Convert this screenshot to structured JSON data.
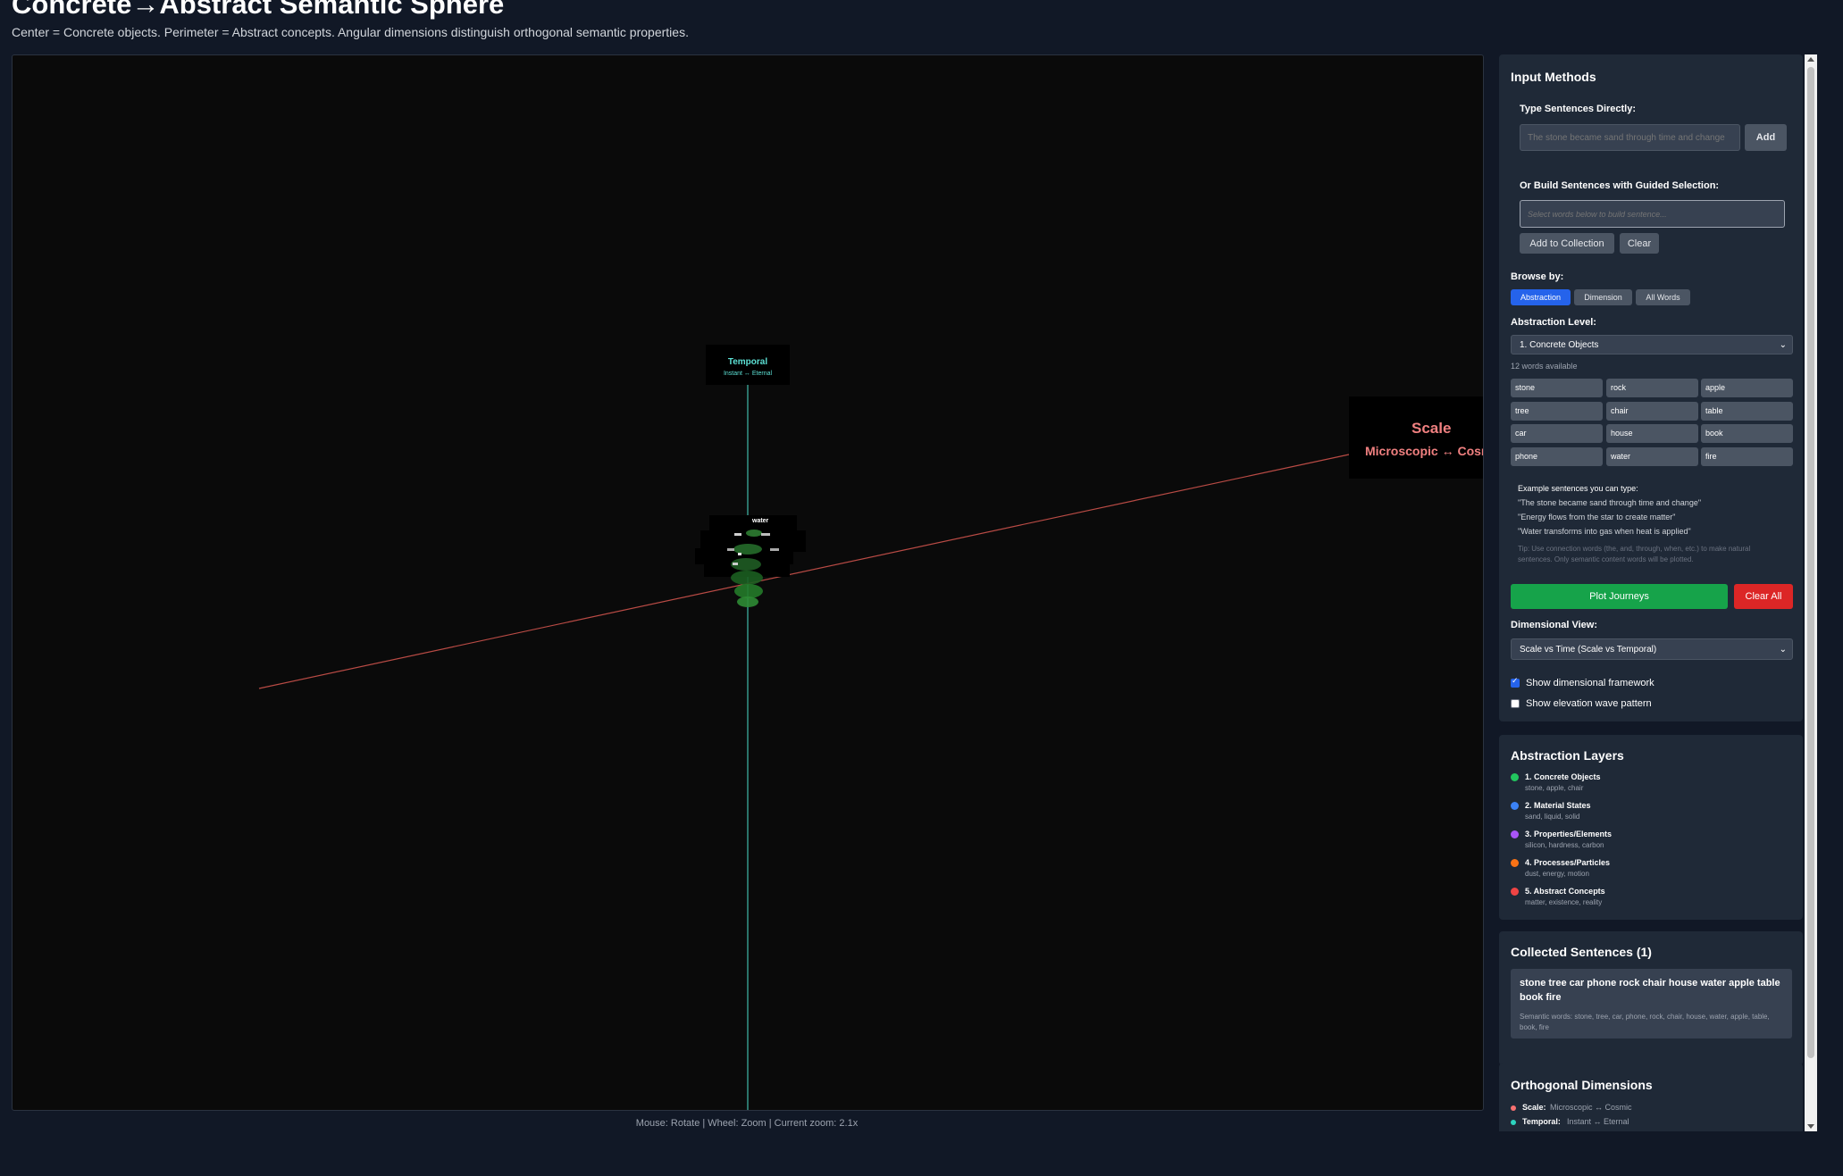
{
  "page": {
    "title": "Concrete→Abstract Semantic Sphere",
    "subtitle": "Center = Concrete objects. Perimeter = Abstract concepts. Angular dimensions distinguish orthogonal semantic properties."
  },
  "viz": {
    "temporal_axis": {
      "name": "Temporal",
      "range": "Instant ↔ Eternal",
      "color": "#5ce0d4"
    },
    "scale_axis": {
      "name": "Scale",
      "range": "Microscopic ↔ Cosmic",
      "color": "#f08080"
    },
    "visible_word": "water",
    "status": "Mouse: Rotate | Wheel: Zoom | Current zoom: 2.1x"
  },
  "input_panel": {
    "title": "Input Methods",
    "type_label": "Type Sentences Directly:",
    "type_placeholder": "The stone became sand through time and change",
    "add_label": "Add",
    "guided_label": "Or Build Sentences with Guided Selection:",
    "guided_placeholder": "Select words below to build sentence...",
    "add_collection_label": "Add to Collection",
    "clear_label": "Clear",
    "browse_label": "Browse by:",
    "browse_tabs": [
      "Abstraction",
      "Dimension",
      "All Words"
    ],
    "active_browse_tab": "Abstraction",
    "level_label": "Abstraction Level:",
    "level_selected": "1. Concrete Objects",
    "words_available": "12 words available",
    "words": [
      "stone",
      "rock",
      "apple",
      "tree",
      "chair",
      "table",
      "car",
      "house",
      "book",
      "phone",
      "water",
      "fire"
    ],
    "examples_title": "Example sentences you can type:",
    "examples": [
      "\"The stone became sand through time and change\"",
      "\"Energy flows from the star to create matter\"",
      "\"Water transforms into gas when heat is applied\""
    ],
    "tip": "Tip: Use connection words (the, and, through, when, etc.) to make natural sentences. Only semantic content words will be plotted.",
    "plot_label": "Plot Journeys",
    "clear_all_label": "Clear All",
    "dim_view_label": "Dimensional View:",
    "dim_view_selected": "Scale vs Time (Scale vs Temporal)",
    "show_framework_label": "Show dimensional framework",
    "show_framework_checked": true,
    "show_wave_label": "Show elevation wave pattern",
    "show_wave_checked": false
  },
  "layers_panel": {
    "title": "Abstraction Layers",
    "layers": [
      {
        "name": "1. Concrete Objects",
        "examples": "stone, apple, chair",
        "color": "#22c55e"
      },
      {
        "name": "2. Material States",
        "examples": "sand, liquid, solid",
        "color": "#3b82f6"
      },
      {
        "name": "3. Properties/Elements",
        "examples": "silicon, hardness, carbon",
        "color": "#a855f7"
      },
      {
        "name": "4. Processes/Particles",
        "examples": "dust, energy, motion",
        "color": "#f97316"
      },
      {
        "name": "5. Abstract Concepts",
        "examples": "matter, existence, reality",
        "color": "#ef4444"
      }
    ]
  },
  "collected_panel": {
    "title": "Collected Sentences (1)",
    "sentences": [
      {
        "text": "stone tree car phone rock chair house water apple table book fire",
        "semantic": "Semantic words: stone, tree, car, phone, rock, chair, house, water, apple, table, book, fire"
      }
    ]
  },
  "dims_panel": {
    "title": "Orthogonal Dimensions",
    "items": [
      {
        "name": "Scale:",
        "range": "Microscopic ↔ Cosmic",
        "color": "#f87171"
      },
      {
        "name": "Temporal:",
        "range": "Instant ↔ Eternal",
        "color": "#2dd4bf"
      }
    ]
  }
}
